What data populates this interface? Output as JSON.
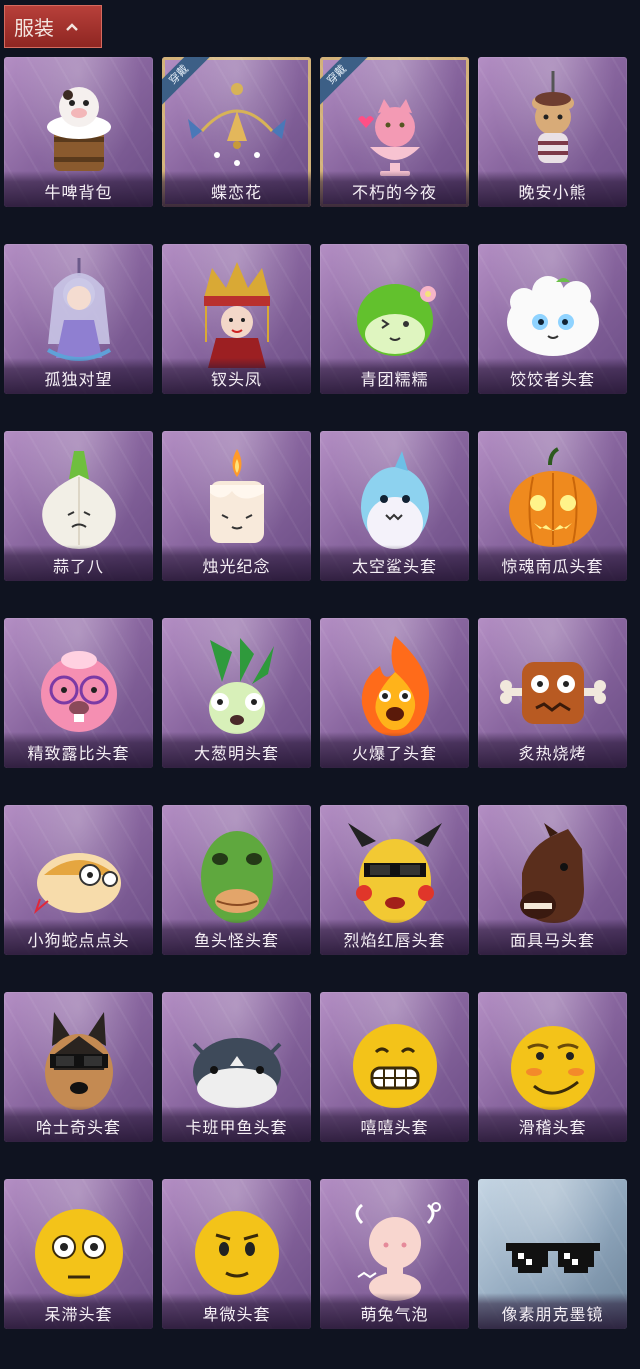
{
  "header": {
    "title": "服装"
  },
  "equipped_label": "穿戴",
  "items": [
    {
      "name": "牛啤背包",
      "icon": "cow-mug-icon",
      "equipped": false
    },
    {
      "name": "蝶恋花",
      "icon": "butterfly-bell-icon",
      "equipped": true
    },
    {
      "name": "不朽的今夜",
      "icon": "fox-cup-icon",
      "equipped": true
    },
    {
      "name": "晚安小熊",
      "icon": "bear-charm-icon",
      "equipped": false
    },
    {
      "name": "孤独对望",
      "icon": "figure-charm-icon",
      "equipped": false
    },
    {
      "name": "钗头凤",
      "icon": "phoenix-crown-icon",
      "equipped": false
    },
    {
      "name": "青团糯糯",
      "icon": "green-dumpling-icon",
      "equipped": false
    },
    {
      "name": "饺饺者头套",
      "icon": "dumpling-head-icon",
      "equipped": false
    },
    {
      "name": "蒜了八",
      "icon": "garlic-icon",
      "equipped": false
    },
    {
      "name": "烛光纪念",
      "icon": "candle-icon",
      "equipped": false
    },
    {
      "name": "太空鲨头套",
      "icon": "shark-head-icon",
      "equipped": false
    },
    {
      "name": "惊魂南瓜头套",
      "icon": "pumpkin-head-icon",
      "equipped": false
    },
    {
      "name": "精致露比头套",
      "icon": "pink-beaver-head-icon",
      "equipped": false
    },
    {
      "name": "大葱明头套",
      "icon": "scallion-head-icon",
      "equipped": false
    },
    {
      "name": "火爆了头套",
      "icon": "fire-head-icon",
      "equipped": false
    },
    {
      "name": "炙热烧烤",
      "icon": "bbq-meat-icon",
      "equipped": false
    },
    {
      "name": "小狗蛇点点头",
      "icon": "snake-head-icon",
      "equipped": false
    },
    {
      "name": "鱼头怪头套",
      "icon": "fish-head-icon",
      "equipped": false
    },
    {
      "name": "烈焰红唇头套",
      "icon": "yellow-mask-icon",
      "equipped": false
    },
    {
      "name": "面具马头套",
      "icon": "horse-head-icon",
      "equipped": false
    },
    {
      "name": "哈士奇头套",
      "icon": "husky-head-icon",
      "equipped": false
    },
    {
      "name": "卡班甲鱼头套",
      "icon": "turtle-head-icon",
      "equipped": false
    },
    {
      "name": "嘻嘻头套",
      "icon": "grin-emoji-icon",
      "equipped": false
    },
    {
      "name": "滑稽头套",
      "icon": "smirk-emoji-icon",
      "equipped": false
    },
    {
      "name": "呆滞头套",
      "icon": "stare-emoji-icon",
      "equipped": false
    },
    {
      "name": "卑微头套",
      "icon": "humble-emoji-icon",
      "equipped": false
    },
    {
      "name": "萌兔气泡",
      "icon": "bunny-bubble-icon",
      "equipped": false
    },
    {
      "name": "像素朋克墨镜",
      "icon": "pixel-sunglasses-icon",
      "equipped": false
    }
  ],
  "colors": {
    "card_purple": "#8a67a0",
    "card_blue": "#8fa6bc",
    "equipped_border": "#d3b27a",
    "header_red": "#a8302b",
    "background": "#0f1320"
  }
}
